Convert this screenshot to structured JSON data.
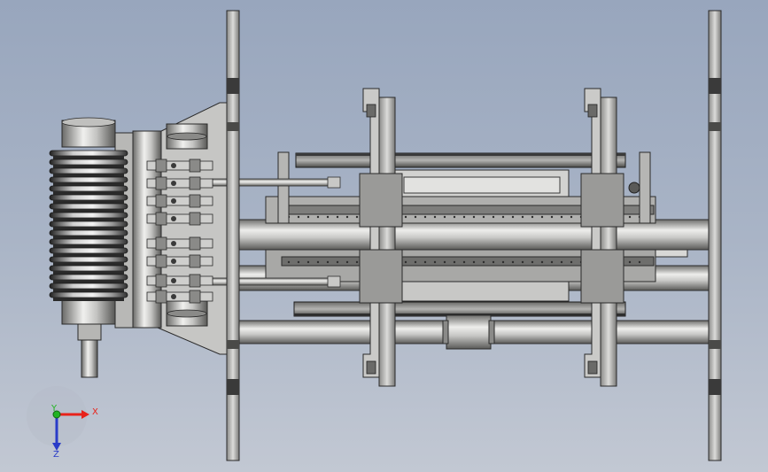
{
  "triad": {
    "x_label": "X",
    "y_label": "Y",
    "z_label": "Z",
    "x_color": "#e8221a",
    "y_color": "#22b322",
    "z_color": "#2a3cc8"
  },
  "colors": {
    "background_top": "#98a6bd",
    "background_bottom": "#c2c8d3",
    "metal_light": "#e4e4e2",
    "metal_mid": "#a8a8a6",
    "metal_dark": "#3e3e3e",
    "outline": "#2a2a2a"
  }
}
